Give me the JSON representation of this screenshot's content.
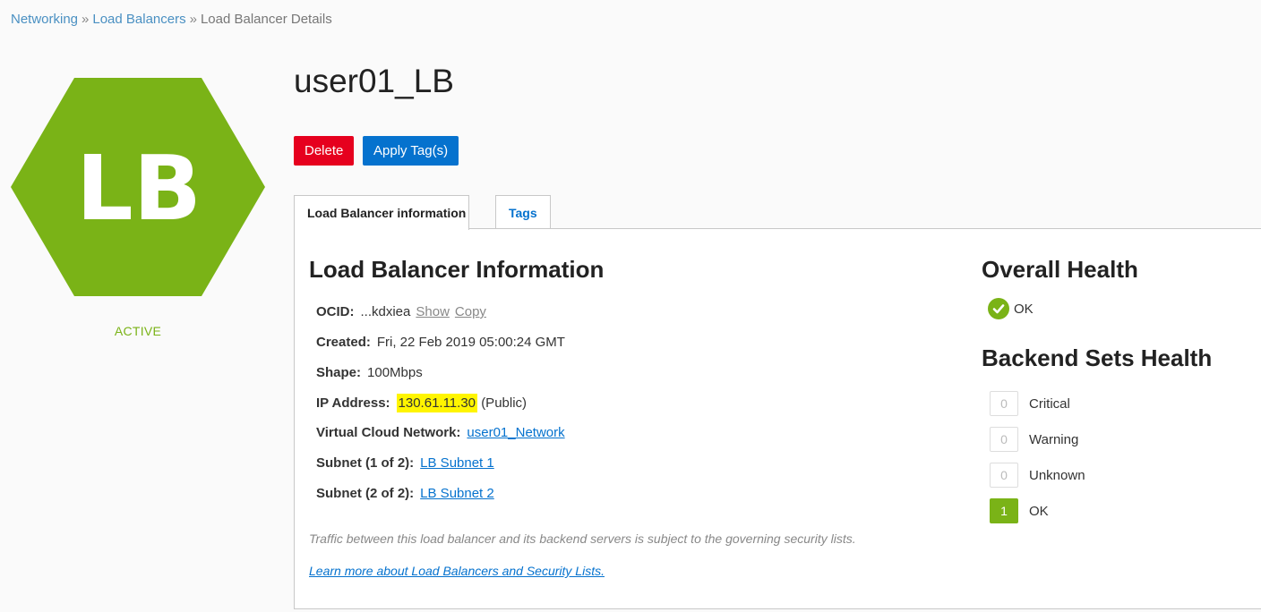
{
  "breadcrumb": {
    "items": [
      "Networking",
      "Load Balancers"
    ],
    "current": "Load Balancer Details",
    "separator": "»"
  },
  "resource": {
    "icon_text": "LB",
    "status": "ACTIVE",
    "name": "user01_LB",
    "color": "#7ab317"
  },
  "actions": {
    "delete_label": "Delete",
    "apply_tags_label": "Apply Tag(s)"
  },
  "tabs": [
    {
      "label": "Load Balancer information"
    },
    {
      "label": "Tags"
    }
  ],
  "info": {
    "title": "Load Balancer Information",
    "ocid_label": "OCID:",
    "ocid_value": "...kdxiea",
    "show_label": "Show",
    "copy_label": "Copy",
    "created_label": "Created:",
    "created_value": "Fri, 22 Feb 2019 05:00:24 GMT",
    "shape_label": "Shape:",
    "shape_value": "100Mbps",
    "ip_label": "IP Address:",
    "ip_value": "130.61.11.30",
    "ip_type": "(Public)",
    "vcn_label": "Virtual Cloud Network:",
    "vcn_value": "user01_Network",
    "subnet1_label": "Subnet (1 of 2):",
    "subnet1_value": "LB Subnet 1",
    "subnet2_label": "Subnet (2 of 2):",
    "subnet2_value": "LB Subnet 2",
    "note": "Traffic between this load balancer and its backend servers is subject to the governing security lists.",
    "learn_more": "Learn more about Load Balancers and Security Lists."
  },
  "overall_health": {
    "title": "Overall Health",
    "status": "OK",
    "icon": "check-circle-icon"
  },
  "backend_sets_health": {
    "title": "Backend Sets Health",
    "rows": [
      {
        "count": "0",
        "label": "Critical"
      },
      {
        "count": "0",
        "label": "Warning"
      },
      {
        "count": "0",
        "label": "Unknown"
      },
      {
        "count": "1",
        "label": "OK"
      }
    ]
  },
  "colors": {
    "accent_green": "#7ab317",
    "danger_red": "#e6001e",
    "primary_blue": "#0572ce",
    "highlight_yellow": "#fff500"
  }
}
